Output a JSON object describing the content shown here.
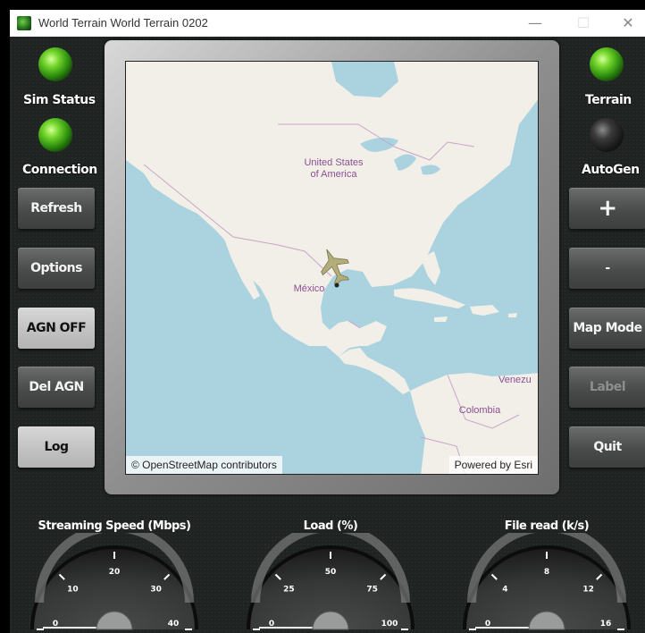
{
  "window": {
    "title": "World Terrain World Terrain 0202",
    "min_glyph": "—",
    "max_glyph": "☐",
    "close_glyph": "✕"
  },
  "indicators": {
    "sim_status": {
      "label": "Sim Status",
      "state": "on"
    },
    "connection": {
      "label": "Connection",
      "state": "on"
    },
    "terrain": {
      "label": "Terrain",
      "state": "on"
    },
    "autogen": {
      "label": "AutoGen",
      "state": "off"
    }
  },
  "left_buttons": {
    "refresh": "Refresh",
    "options": "Options",
    "agn_off": "AGN OFF",
    "del_agn": "Del AGN",
    "log": "Log"
  },
  "right_buttons": {
    "zoom_in": "+",
    "zoom_out": "-",
    "map_mode": "Map Mode",
    "label": "Label",
    "quit": "Quit"
  },
  "map": {
    "labels": {
      "usa_line1": "United States",
      "usa_line2": "of America",
      "mexico": "México",
      "colombia": "Colombia",
      "venezuela": "Venezu"
    },
    "attribution_left": "© OpenStreetMap contributors",
    "attribution_right": "Powered by Esri",
    "aircraft_icon": "jet-aircraft-icon"
  },
  "gauges": [
    {
      "title": "Streaming Speed (Mbps)",
      "ticks": [
        "0",
        "10",
        "20",
        "30",
        "40"
      ],
      "value": 0
    },
    {
      "title": "Load (%)",
      "ticks": [
        "0",
        "25",
        "50",
        "75",
        "100"
      ],
      "value": 0
    },
    {
      "title": "File read (k/s)",
      "ticks": [
        "0",
        "4",
        "8",
        "12",
        "16"
      ],
      "value": 0
    }
  ],
  "colors": {
    "led_on": "#5fc71f",
    "led_off": "#2a2a2a",
    "water": "#aad3df",
    "land": "#f2efe9"
  }
}
